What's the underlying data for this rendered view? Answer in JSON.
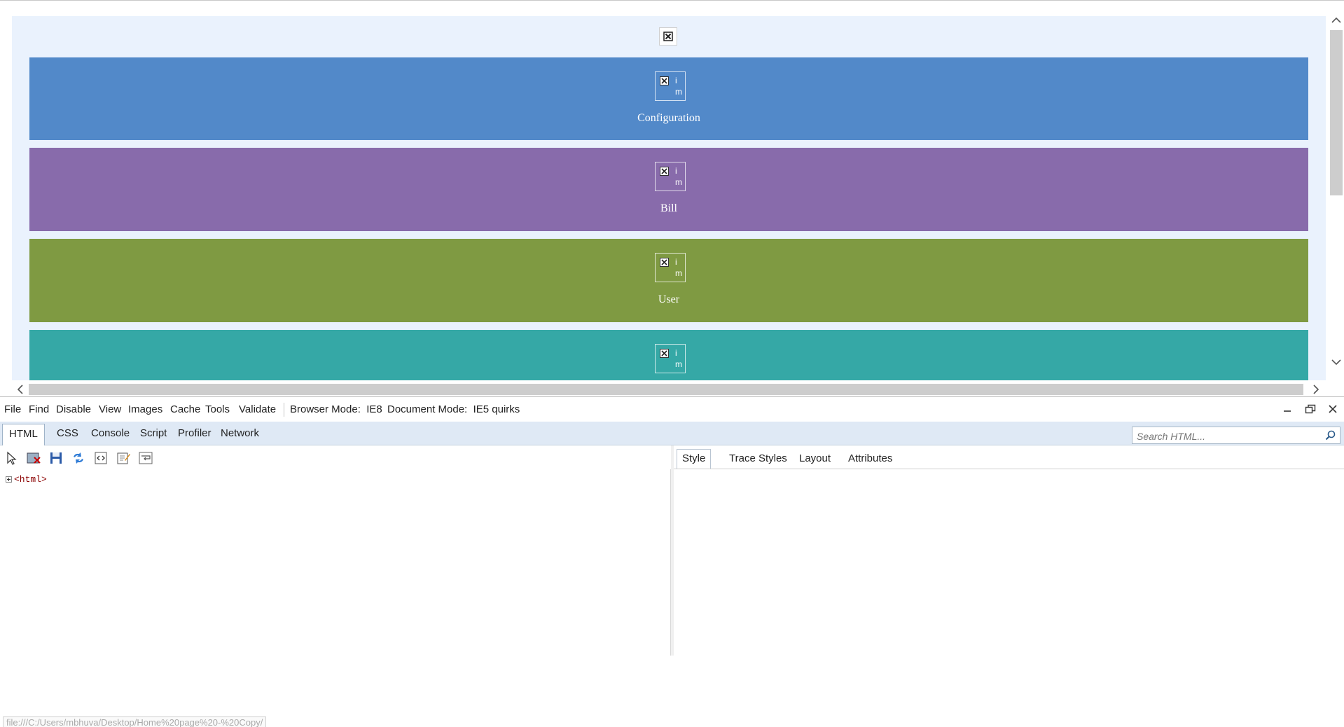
{
  "page": {
    "tiles": [
      {
        "label": "Configuration",
        "color": "#5289c9",
        "alt": "i\nm"
      },
      {
        "label": "Bill",
        "color": "#886bab",
        "alt": "i\nm"
      },
      {
        "label": "User",
        "color": "#7f9a42",
        "alt": "i\nm"
      },
      {
        "label": "",
        "color": "#35a8a6",
        "alt": "i\nm"
      }
    ],
    "alt_line1": "i",
    "alt_line2": "m"
  },
  "devtools": {
    "menu": [
      "File",
      "Find",
      "Disable",
      "View",
      "Images",
      "Cache",
      "Tools",
      "Validate"
    ],
    "browser_mode_label": "Browser Mode:",
    "browser_mode_value": "IE8",
    "document_mode_label": "Document Mode:",
    "document_mode_value": "IE5 quirks",
    "tabs": [
      "HTML",
      "CSS",
      "Console",
      "Script",
      "Profiler",
      "Network"
    ],
    "active_tab": "HTML",
    "search_placeholder": "Search HTML...",
    "tree_root": "<html>",
    "right_tabs": [
      "Style",
      "Trace Styles",
      "Layout",
      "Attributes"
    ],
    "active_right_tab": "Style",
    "status_url": "file:///C:/Users/mbhuva/Desktop/Home%20page%20-%20Copy/"
  }
}
